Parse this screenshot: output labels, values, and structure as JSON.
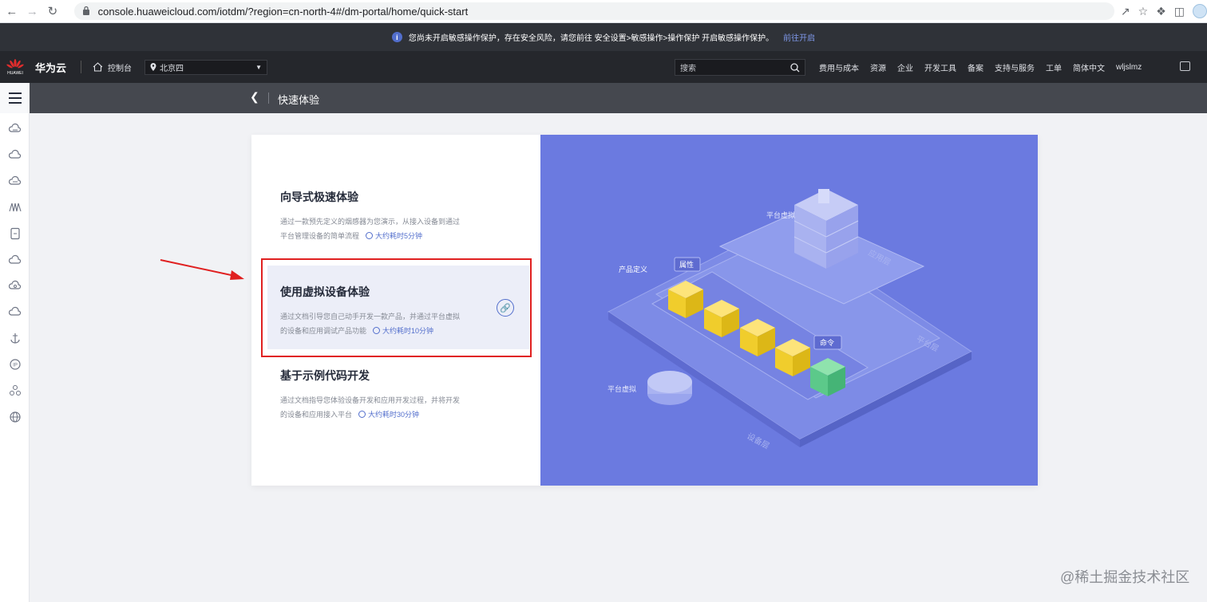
{
  "browser": {
    "url": "console.huaweicloud.com/iotdm/?region=cn-north-4#/dm-portal/home/quick-start"
  },
  "warning": {
    "text": "您尚未开启敏感操作保护，存在安全风险，请您前往 安全设置>敏感操作>操作保护 开启敏感操作保护。",
    "link": "前往开启"
  },
  "header": {
    "logo_text": "HUAWEI",
    "brand": "华为云",
    "console": "控制台",
    "region": "北京四",
    "search_placeholder": "搜索",
    "menu": [
      "费用与成本",
      "资源",
      "企业",
      "开发工具",
      "备案",
      "支持与服务",
      "工单",
      "简体中文",
      "wljslmz"
    ]
  },
  "subheader": {
    "title": "快速体验"
  },
  "options": [
    {
      "title": "向导式极速体验",
      "desc1": "通过一款预先定义的烟感器为您演示，从接入设备到通过",
      "desc2": "平台管理设备的简单流程",
      "time": "大约耗时5分钟"
    },
    {
      "title": "使用虚拟设备体验",
      "desc1": "通过文档引导您自己动手开发一款产品，并通过平台虚拟",
      "desc2": "的设备和应用调试产品功能",
      "time": "大约耗时10分钟"
    },
    {
      "title": "基于示例代码开发",
      "desc1": "通过文档指导您体验设备开发和应用开发过程，并将开发",
      "desc2": "的设备和应用接入平台",
      "time": "大约耗时30分钟"
    }
  ],
  "illustration": {
    "labels": {
      "platform_virtual_top": "平台虚拟",
      "product_def": "产品定义",
      "property": "属性",
      "command": "命令",
      "platform_virtual_bottom": "平台虚拟",
      "app_layer": "应用层",
      "platform_layer": "平台层",
      "device_layer": "设备层"
    }
  },
  "watermark": "@稀土掘金技术社区",
  "colors": {
    "accent": "#526ecc",
    "illustration_bg": "#6b7ae0",
    "highlight_border": "#e02020",
    "cube_yellow": "#f5d33a",
    "cube_green": "#5cc98a"
  }
}
